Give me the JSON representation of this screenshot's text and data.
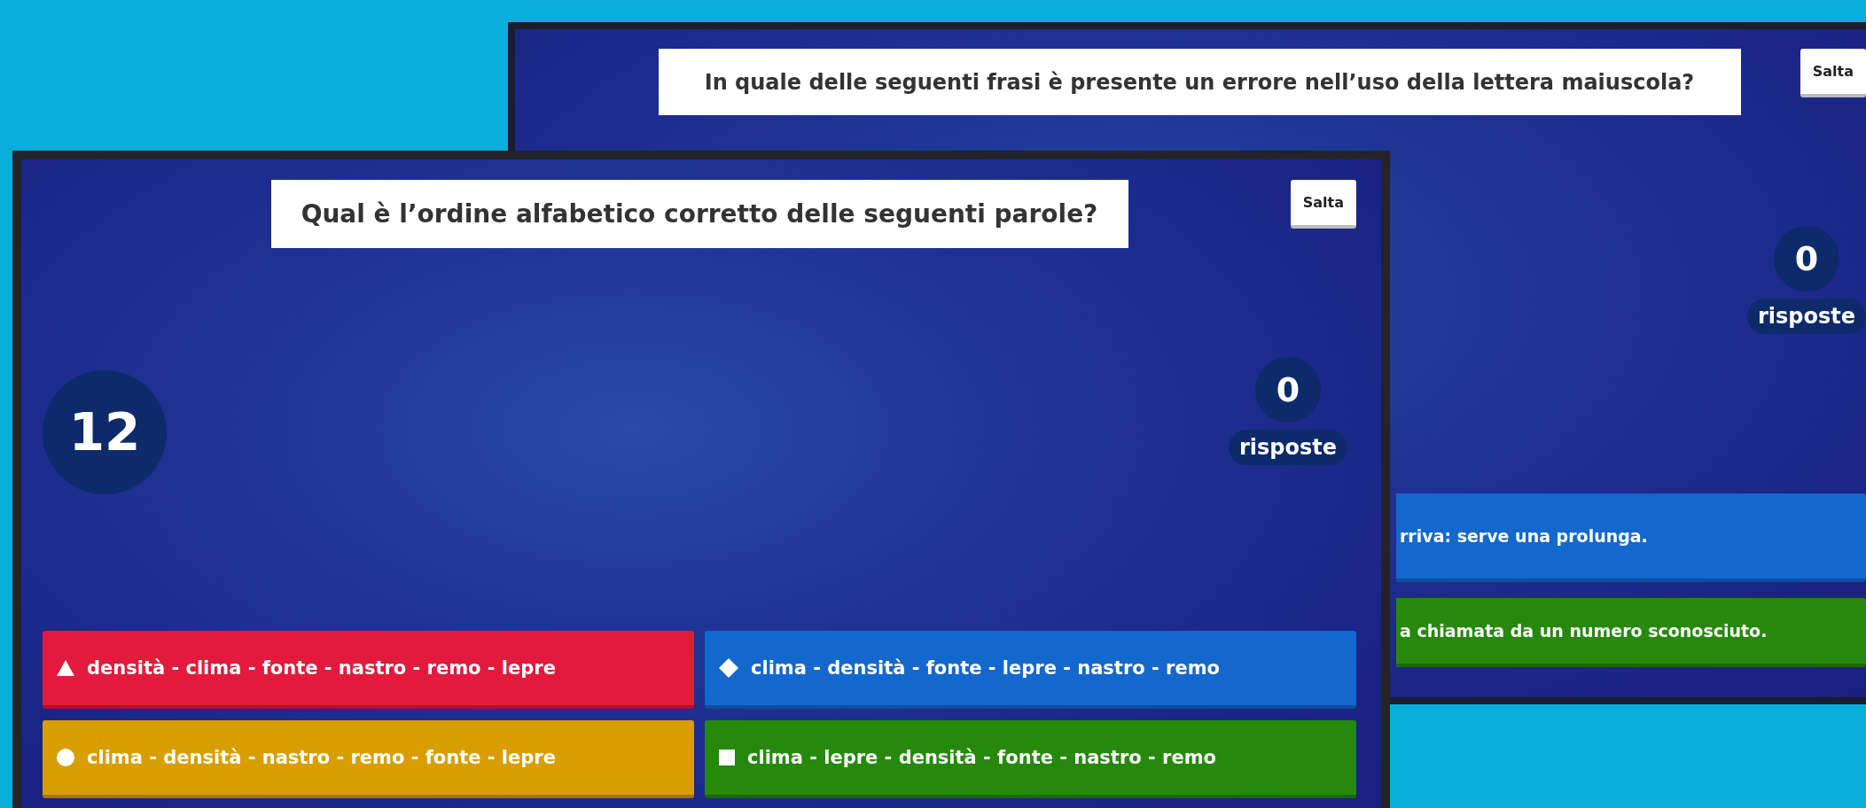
{
  "windows": [
    {
      "kind": "back",
      "question": "In quale delle seguenti frasi è presente un errore nell’uso della lettera maiuscola?",
      "skip_button": "Salta",
      "answer_count": "0",
      "answer_count_label": "risposte",
      "answers": [
        {
          "color": "#1368ce",
          "text": "rriva: serve una prolunga."
        },
        {
          "color": "#26890c",
          "text": "a chiamata da un numero sconosciuto."
        }
      ]
    },
    {
      "kind": "front",
      "question": "Qual è l’ordine alfabetico corretto delle seguenti parole?",
      "skip_button": "Salta",
      "timer": "12",
      "answer_count": "0",
      "answer_count_label": "risposte",
      "answers": [
        {
          "kind": "triangle",
          "color": "#e21b3c",
          "text": "densità - clima - fonte - nastro - remo - lepre"
        },
        {
          "kind": "diamond",
          "color": "#1368ce",
          "text": "clima - densità - fonte - lepre - nastro - remo"
        },
        {
          "kind": "circle",
          "color": "#d89e00",
          "text": "clima - densità - nastro - remo - fonte - lepre"
        },
        {
          "kind": "square",
          "color": "#26890c",
          "text": "clima - lepre - densità - fonte - nastro - remo"
        }
      ]
    }
  ]
}
